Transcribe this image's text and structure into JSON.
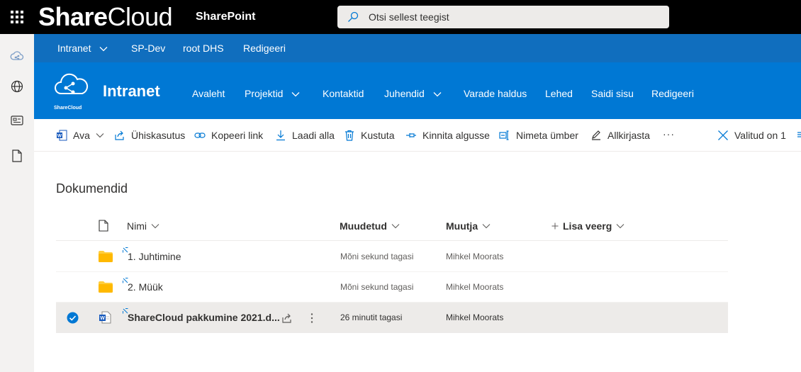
{
  "topbar": {
    "brand_bold": "Share",
    "brand_light": "Cloud",
    "product": "SharePoint",
    "search_placeholder": "Otsi sellest teegist"
  },
  "hubnav": {
    "items": [
      "Intranet",
      "SP-Dev",
      "root DHS",
      "Redigeeri"
    ]
  },
  "site": {
    "logo_text": "ShareCloud",
    "title": "Intranet",
    "nav": [
      "Avaleht",
      "Projektid",
      "Kontaktid",
      "Juhendid",
      "Varade haldus",
      "Lehed",
      "Saidi sisu",
      "Redigeeri"
    ]
  },
  "commandbar": {
    "open": "Ava",
    "share": "Ühiskasutus",
    "copy_link": "Kopeeri link",
    "download": "Laadi alla",
    "delete": "Kustuta",
    "pin": "Kinnita algusse",
    "rename": "Nimeta ümber",
    "sign": "Allkirjasta",
    "more": "···",
    "selected": "Valitud on 1"
  },
  "library": {
    "title": "Dokumendid",
    "columns": {
      "name": "Nimi",
      "modified": "Muudetud",
      "modified_by": "Muutja",
      "add_column": "Lisa veerg"
    },
    "rows": [
      {
        "name": "1. Juhtimine",
        "modified": "Mõni sekund tagasi",
        "modified_by": "Mihkel Moorats"
      },
      {
        "name": "2. Müük",
        "modified": "Mõni sekund tagasi",
        "modified_by": "Mihkel Moorats"
      },
      {
        "name": "ShareCloud pakkumine 2021.d...",
        "modified": "26 minutit tagasi",
        "modified_by": "Mihkel Moorats"
      }
    ]
  },
  "colors": {
    "topbar": "#000000",
    "hubnav": "#106ebe",
    "site_header": "#0078d4",
    "selected_row": "#edebe9",
    "folder": "#ffce3d",
    "word": "#185abd"
  }
}
